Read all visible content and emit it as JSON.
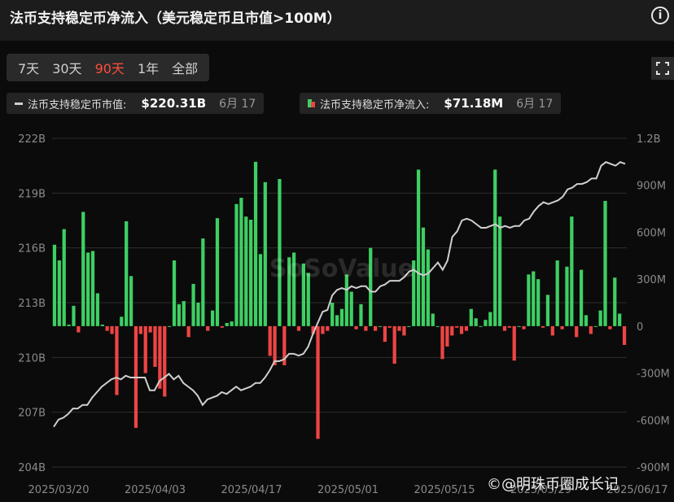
{
  "header": {
    "title": "法币支持稳定币净流入（美元稳定币且市值>100M）",
    "info_icon": "info-icon"
  },
  "range_tabs": [
    {
      "label": "7天",
      "active": false
    },
    {
      "label": "30天",
      "active": false
    },
    {
      "label": "90天",
      "active": true
    },
    {
      "label": "1年",
      "active": false
    },
    {
      "label": "全部",
      "active": false
    }
  ],
  "fullscreen_icon": "fullscreen-icon",
  "legend": {
    "market_cap": {
      "label": "法币支持稳定币市值:",
      "value": "$220.31B",
      "date": "6月 17"
    },
    "net_inflow": {
      "label": "法币支持稳定币净流入:",
      "value": "$71.18M",
      "date": "6月 17"
    }
  },
  "watermark": "SoSoValue",
  "footer_watermark": "©@明珠币圈成长记",
  "colors": {
    "positive": "#3ecf63",
    "negative": "#ef4444",
    "line": "#cfcfcf",
    "accent": "#ff4d3d"
  },
  "chart_data": {
    "type": "bar",
    "x_tick_labels": [
      "2025/03/20",
      "2025/04/03",
      "2025/04/17",
      "2025/05/01",
      "2025/05/15",
      "2025/05/29",
      "2025/06/17"
    ],
    "y_left": {
      "label": "",
      "ticks": [
        "204B",
        "207B",
        "210B",
        "213B",
        "216B",
        "219B",
        "222B"
      ],
      "range": [
        204,
        222
      ]
    },
    "y_right": {
      "label": "",
      "ticks": [
        "-900M",
        "-600M",
        "-300M",
        "0",
        "300M",
        "600M",
        "900M",
        "1.2B"
      ],
      "range": [
        -900,
        1200
      ]
    },
    "series": [
      {
        "name": "法币支持稳定币净流入",
        "type": "bar",
        "axis": "right",
        "values": [
          520,
          420,
          620,
          10,
          130,
          -40,
          730,
          470,
          480,
          210,
          10,
          -30,
          -50,
          -440,
          60,
          670,
          320,
          -650,
          -50,
          -300,
          -40,
          -260,
          -400,
          -450,
          0,
          420,
          140,
          160,
          -70,
          270,
          150,
          560,
          -30,
          100,
          690,
          -10,
          20,
          30,
          780,
          820,
          700,
          680,
          1050,
          460,
          920,
          -190,
          -250,
          940,
          -250,
          440,
          470,
          -30,
          400,
          340,
          -50,
          -720,
          -50,
          -30,
          150,
          70,
          110,
          330,
          220,
          -20,
          140,
          -30,
          500,
          -30,
          0,
          -100,
          -10,
          -240,
          -30,
          -60,
          0,
          420,
          1000,
          630,
          490,
          80,
          0,
          -210,
          -130,
          -60,
          -10,
          -50,
          -30,
          110,
          50,
          0,
          40,
          90,
          1000,
          700,
          -30,
          -10,
          -220,
          0,
          -20,
          330,
          350,
          300,
          -10,
          200,
          -60,
          420,
          -20,
          380,
          700,
          -70,
          360,
          70,
          -50,
          0,
          100,
          800,
          -20,
          310,
          80,
          -120
        ],
        "unit": "M"
      },
      {
        "name": "法币支持稳定币市值",
        "type": "line",
        "axis": "left",
        "values": [
          206.2,
          206.6,
          206.7,
          206.9,
          207.2,
          207.2,
          207.4,
          207.4,
          207.8,
          208.1,
          208.4,
          208.6,
          208.8,
          208.9,
          208.8,
          209.0,
          208.9,
          208.9,
          208.9,
          208.9,
          208.2,
          208.2,
          208.7,
          208.9,
          209.1,
          208.8,
          209.0,
          208.6,
          208.4,
          208.2,
          207.9,
          207.4,
          207.7,
          207.8,
          207.9,
          208.1,
          208.0,
          208.2,
          208.4,
          208.2,
          208.3,
          208.4,
          208.6,
          208.6,
          208.9,
          209.3,
          209.8,
          209.8,
          209.9,
          210.2,
          210.2,
          210.1,
          210.2,
          210.6,
          211.3,
          211.9,
          212.5,
          212.6,
          213.4,
          213.7,
          213.8,
          213.7,
          213.9,
          213.8,
          213.9,
          213.9,
          213.6,
          213.6,
          213.9,
          214.0,
          214.2,
          214.2,
          214.2,
          214.4,
          214.7,
          214.8,
          214.6,
          214.5,
          214.6,
          214.9,
          215.2,
          214.8,
          215.3,
          216.6,
          216.9,
          217.5,
          217.6,
          217.5,
          217.3,
          217.1,
          217.1,
          217.2,
          217.3,
          217.1,
          217.2,
          217.1,
          217.2,
          217.2,
          217.5,
          217.6,
          218.0,
          218.3,
          218.5,
          218.4,
          218.5,
          218.6,
          218.8,
          219.2,
          219.3,
          219.5,
          219.5,
          219.6,
          219.8,
          219.8,
          220.5,
          220.7,
          220.6,
          220.5,
          220.7,
          220.6
        ]
      }
    ],
    "grid": true,
    "legend_position": "top-left"
  }
}
